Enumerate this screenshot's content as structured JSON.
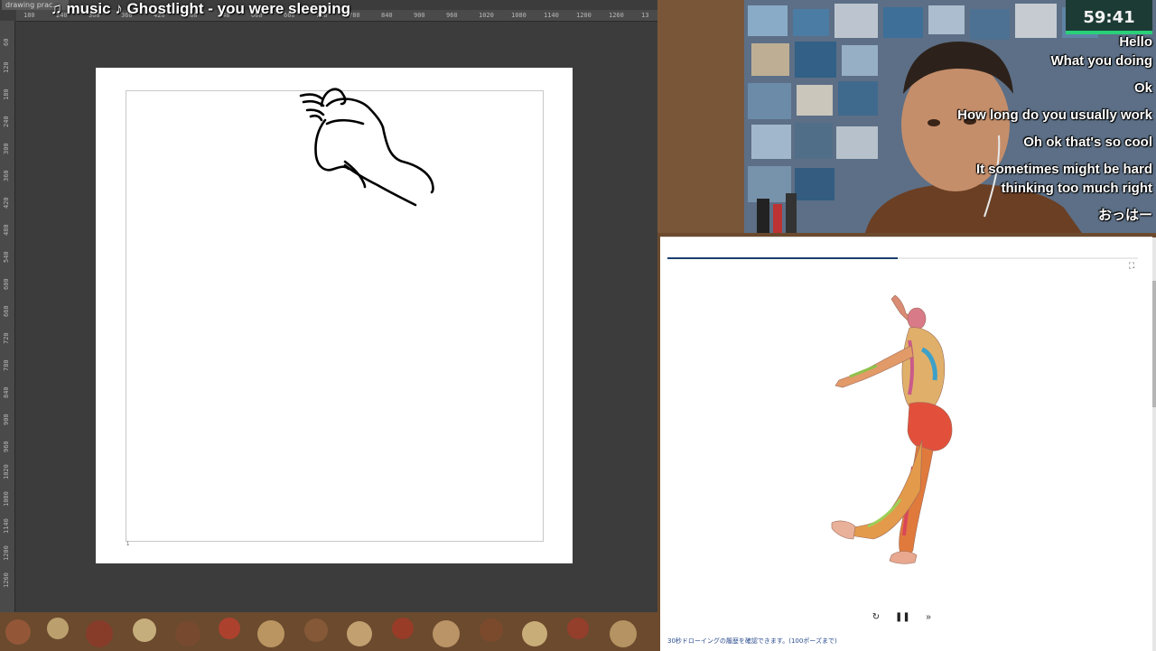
{
  "app": {
    "tab_label": "drawing prac…",
    "ruler_top_ticks": [
      "180",
      "240",
      "300",
      "360",
      "420",
      "480",
      "540",
      "600",
      "660",
      "720",
      "780",
      "840",
      "900",
      "960",
      "1020",
      "1080",
      "1140",
      "1200",
      "1260",
      "13"
    ],
    "ruler_left_ticks": [
      "60",
      "120",
      "180",
      "240",
      "300",
      "360",
      "420",
      "480",
      "540",
      "600",
      "660",
      "720",
      "780",
      "840",
      "900",
      "960",
      "1020",
      "1080",
      "1140",
      "1200",
      "1260"
    ],
    "canvas_number": "1"
  },
  "overlay": {
    "music_title": "♫ music ♪ Ghostlight - you were sleeping"
  },
  "stream": {
    "timer": "59:41",
    "chat": [
      "Hello",
      "What you doing",
      "Ok",
      "How long do you usually work",
      "Oh ok that's so cool",
      "It sometimes might be hard",
      "thinking too much right",
      "おっはー"
    ]
  },
  "reference": {
    "progress": 0.49,
    "caption": "30秒ドローイングの履歴を確認できます。(100ポーズまで)",
    "icons": {
      "fullscreen": "fullscreen-icon",
      "restart": "restart-icon",
      "pause": "pause-icon",
      "skip": "skip-forward-icon"
    }
  },
  "colors": {
    "app_bg": "#3c3c3c",
    "ruler_bg": "#4a4a4a",
    "timer_bg": "#1d3b35",
    "timer_accent": "#29d07a",
    "progress_fill": "#1c3e6e"
  }
}
